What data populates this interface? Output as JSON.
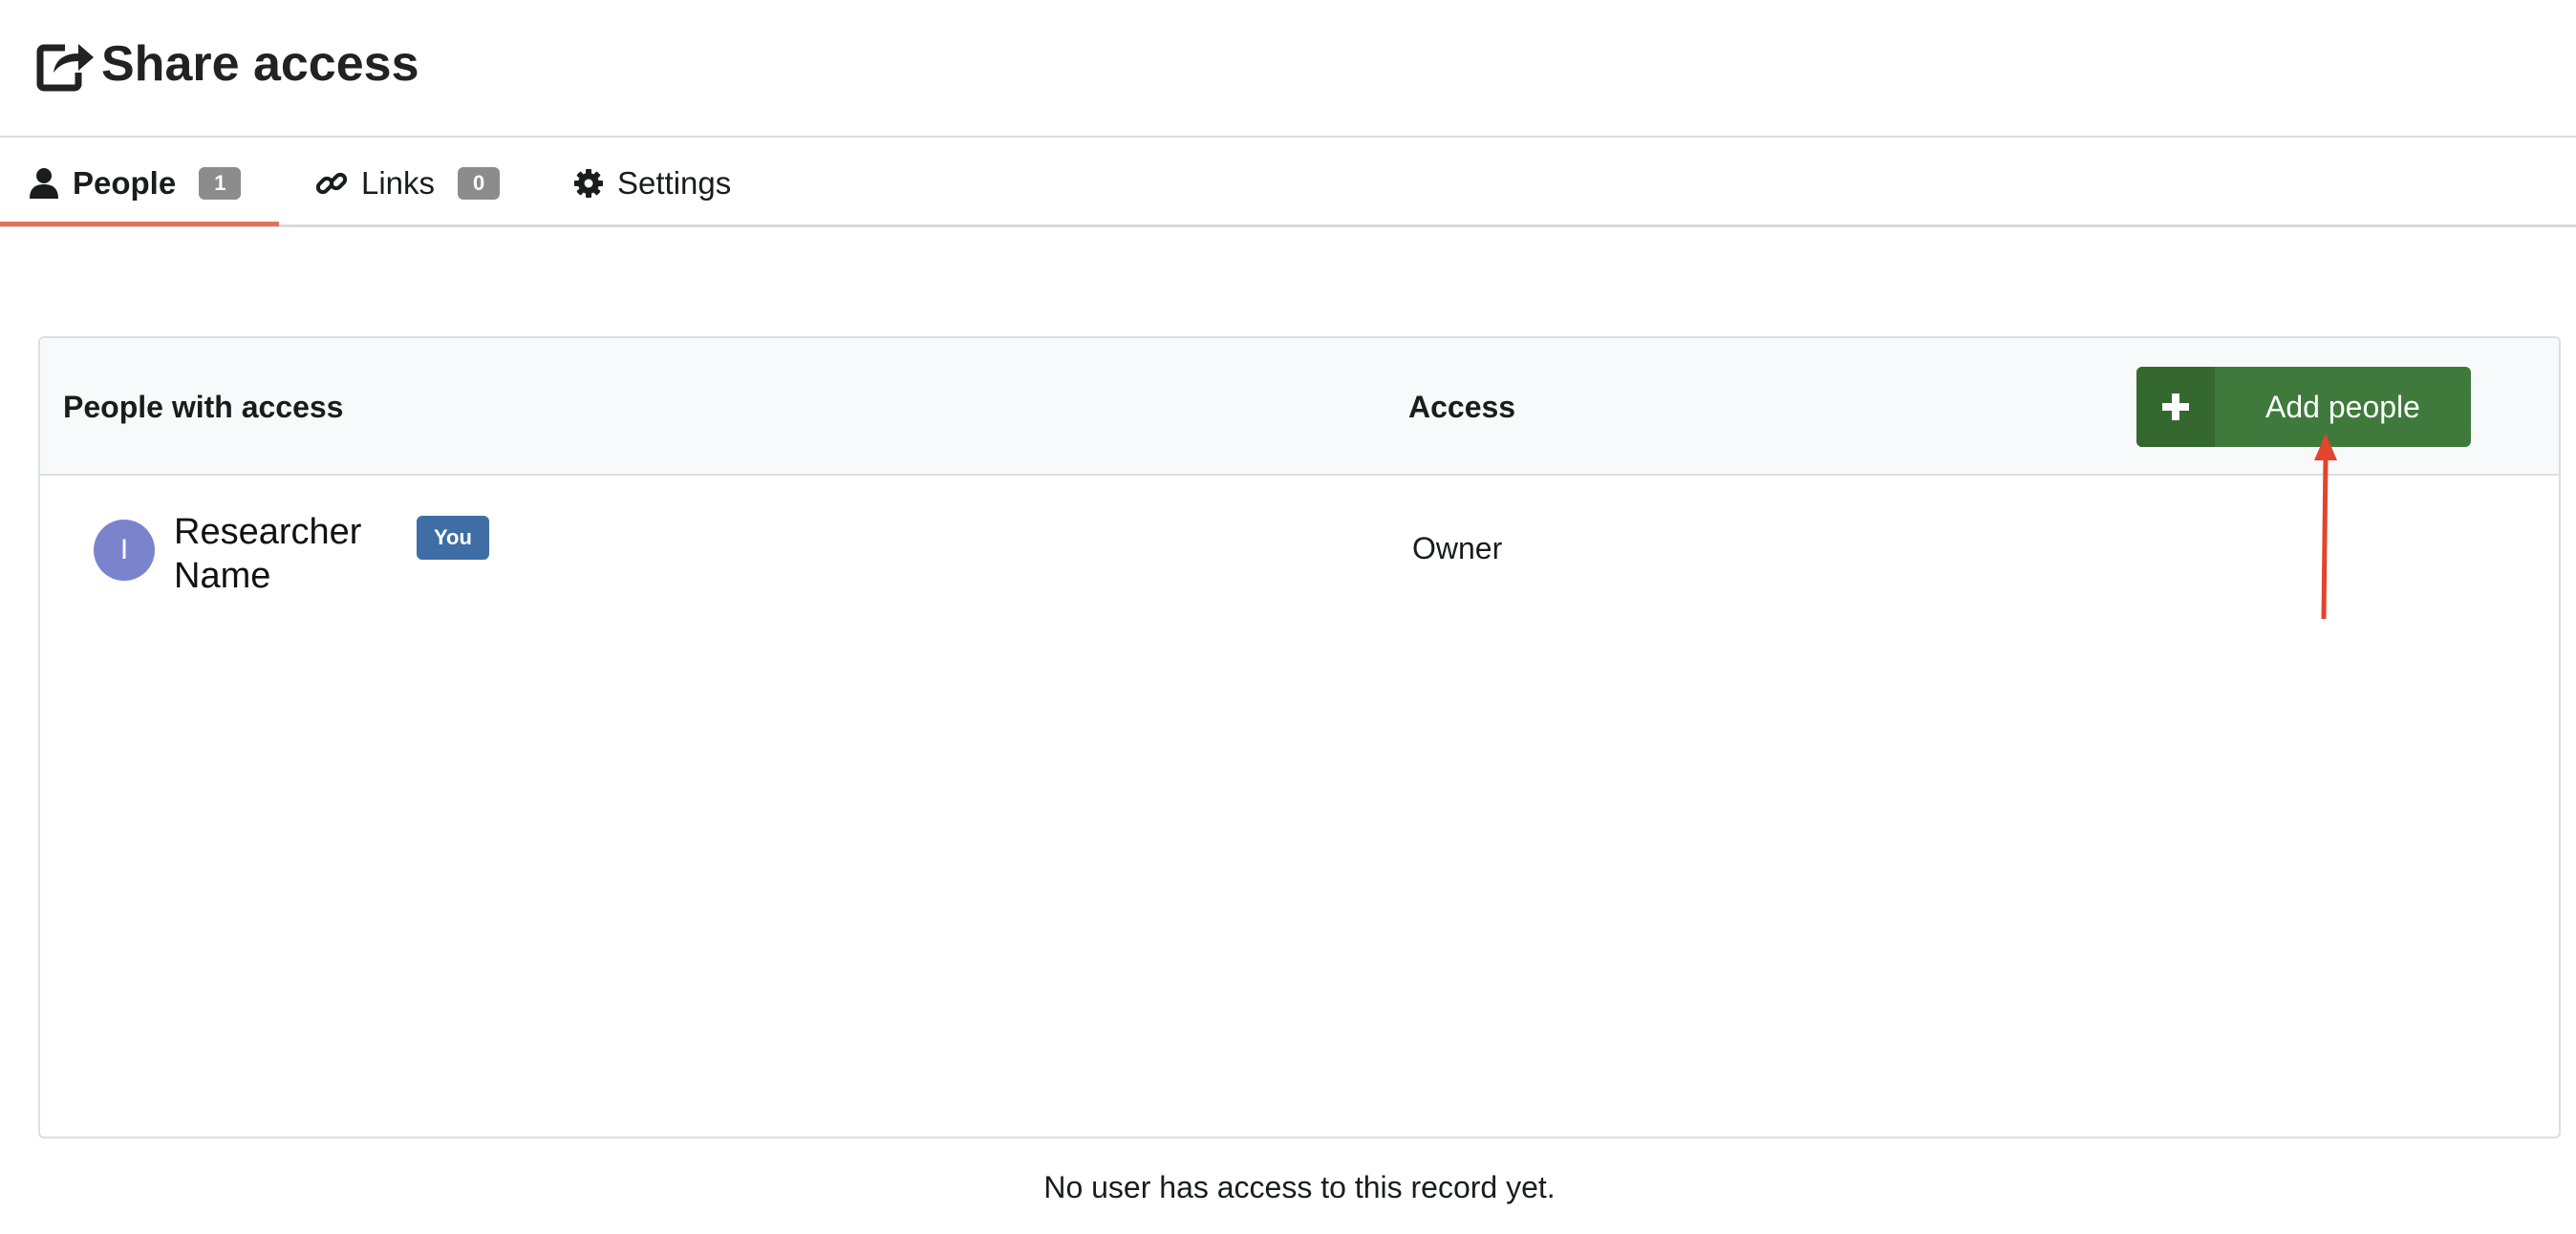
{
  "header": {
    "title": "Share access",
    "icon": "share-square-icon"
  },
  "tabs": [
    {
      "label": "People",
      "count": "1",
      "icon": "user-icon",
      "active": true
    },
    {
      "label": "Links",
      "count": "0",
      "icon": "link-icon",
      "active": false
    },
    {
      "label": "Settings",
      "icon": "gear-icon",
      "active": false
    }
  ],
  "table": {
    "col_people": "People with access",
    "col_access": "Access",
    "add_button": "Add people",
    "rows": [
      {
        "initial": "I",
        "name": "Researcher Name",
        "badge": "You",
        "access": "Owner"
      }
    ]
  },
  "footer": {
    "message": "No user has access to this record yet."
  },
  "colors": {
    "accent_underline": "#e2725b",
    "add_button": "#3f7a3c",
    "you_badge": "#3f6ea6",
    "avatar": "#7b83cc",
    "annotation_arrow": "#e2442c"
  }
}
